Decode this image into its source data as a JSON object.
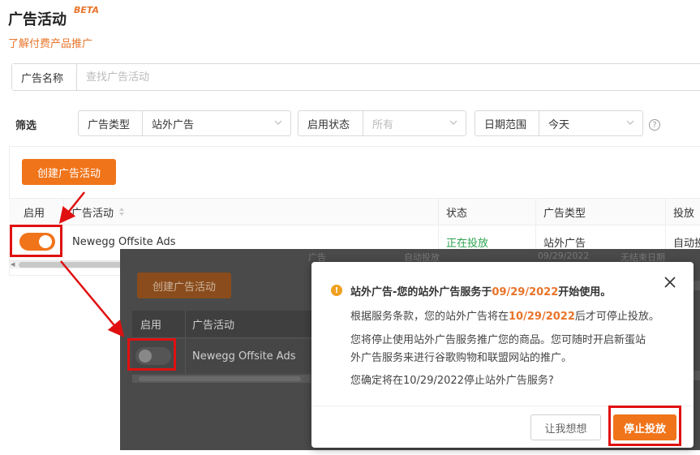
{
  "header": {
    "title": "广告活动",
    "beta": "BETA",
    "learn_link": "了解付费产品推广"
  },
  "search": {
    "label": "广告名称",
    "placeholder": "查找广告活动"
  },
  "filters": {
    "label": "筛选",
    "ad_type": {
      "label": "广告类型",
      "value": "站外广告"
    },
    "status": {
      "label": "启用状态",
      "value": "所有"
    },
    "date_range": {
      "label": "日期范围",
      "value": "今天"
    },
    "help": "?"
  },
  "toolbar": {
    "create_label": "创建广告活动"
  },
  "table": {
    "columns": [
      "启用",
      "广告活动",
      "状态",
      "广告类型",
      "投放"
    ],
    "rows": [
      {
        "enabled": true,
        "campaign": "Newegg Offsite Ads",
        "status": "正在投放",
        "ad_type": "站外广告",
        "delivery": "自动投放"
      }
    ]
  },
  "overlay": {
    "create_label": "创建广告活动",
    "columns": [
      "启用",
      "广告活动"
    ],
    "campaign": "Newegg Offsite Ads",
    "enabled": false,
    "strip": {
      "a": "广告",
      "b": "自动投放",
      "c": "09/29/2022",
      "d": "无结束日期"
    }
  },
  "modal": {
    "title_prefix": "站外广告-您的站外广告服务于",
    "title_date": "09/29/2022",
    "title_suffix": "开始使用。",
    "line1_prefix": "根据服务条款，您的站外广告将在",
    "line1_date": "10/29/2022",
    "line1_suffix": "后才可停止投放。",
    "line2": "您将停止使用站外广告服务推广您的商品。您可随时开启新蛋站",
    "line3": "外广告服务来进行谷歌购物和联盟网站的推广。",
    "line4": "您确定将在10/29/2022停止站外广告服务?",
    "cancel_label": "让我想想",
    "confirm_label": "停止投放"
  },
  "colors": {
    "accent": "#f0741a",
    "status_active": "#2ea44f",
    "annotation": "#e01010"
  }
}
